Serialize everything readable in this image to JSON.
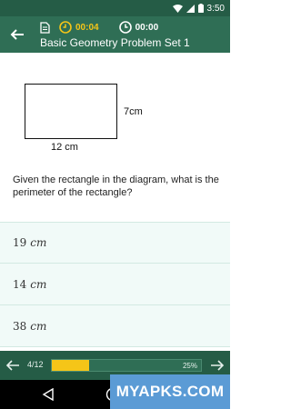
{
  "status_bar": {
    "time": "3:50",
    "icons": [
      "wifi-icon",
      "signal-icon",
      "battery-icon"
    ]
  },
  "header": {
    "back_icon": "arrow-left-icon",
    "notes_icon": "document-icon",
    "timer_icon": "clock-icon",
    "elapsed": "00:04",
    "stopwatch_icon": "clock-icon",
    "remaining": "00:00",
    "title": "Basic Geometry Problem Set 1"
  },
  "diagram": {
    "height_label": "7cm",
    "width_label": "12 cm"
  },
  "question": "Given the rectangle in the diagram, what is the perimeter of the rectangle?",
  "choices": [
    {
      "value": "19",
      "unit": "cm"
    },
    {
      "value": "14",
      "unit": "cm"
    },
    {
      "value": "38",
      "unit": "cm"
    }
  ],
  "footer": {
    "counter": "4/12",
    "percent": "25%",
    "progress_fraction": 0.25,
    "prev_icon": "arrow-left-icon",
    "next_icon": "arrow-right-icon"
  },
  "watermark": "MYAPKS.COM",
  "colors": {
    "primary": "#2f6e55",
    "primary_dark": "#255c46",
    "accent": "#f5c518",
    "choice_bg": "#f1faf8"
  }
}
